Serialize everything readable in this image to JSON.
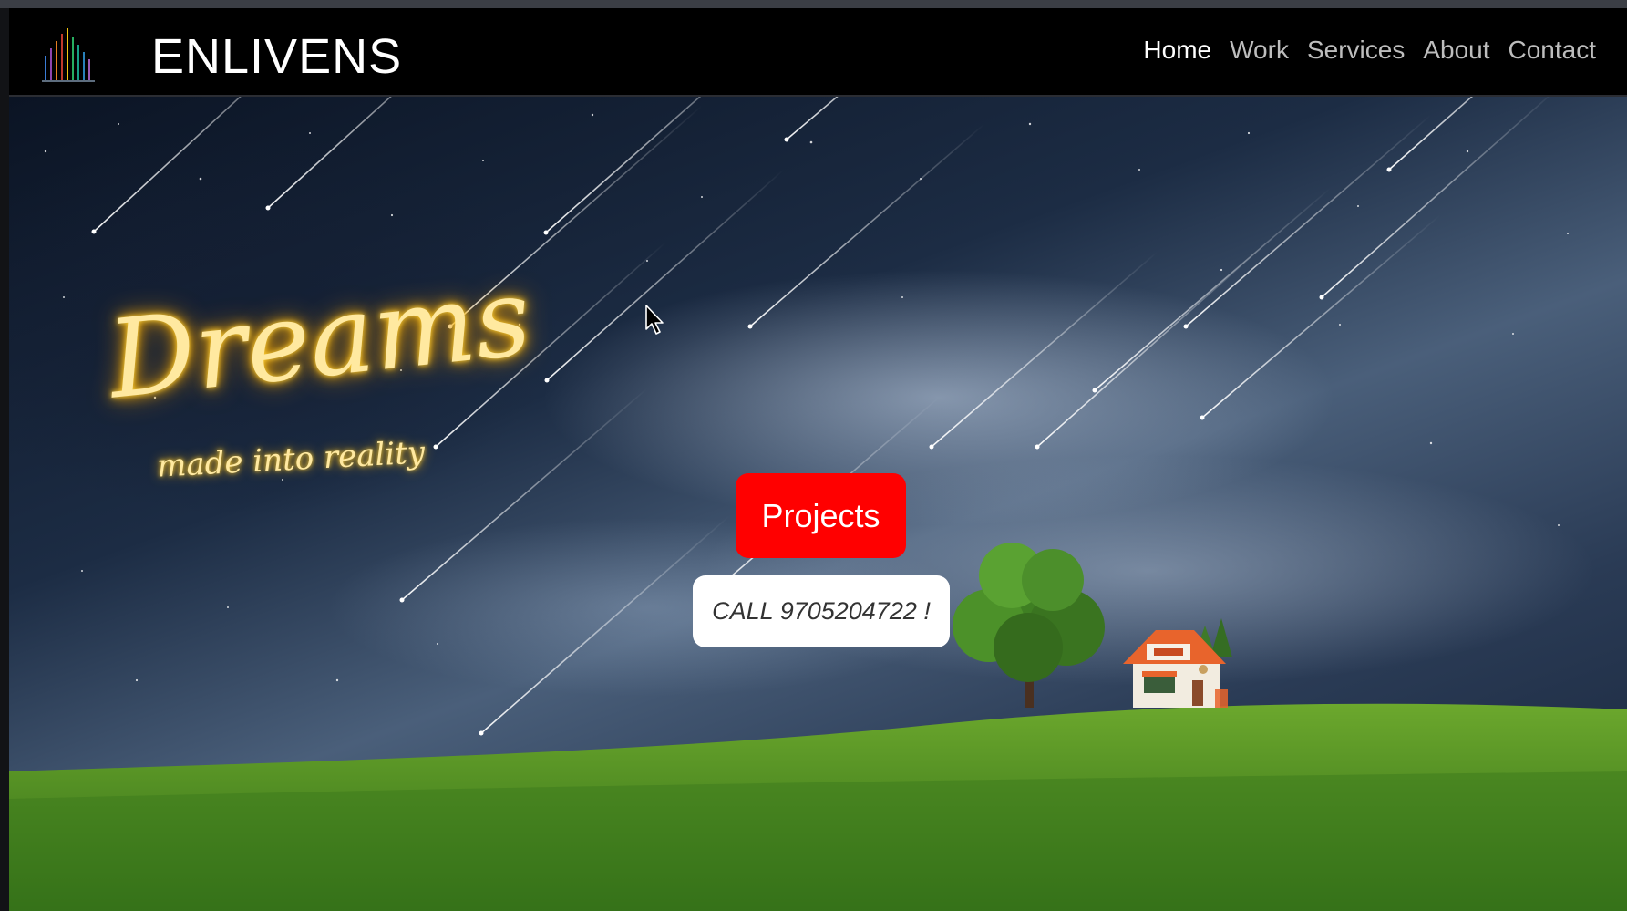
{
  "header": {
    "brand": "ENLIVENS",
    "nav": [
      "Home",
      "Work",
      "Services",
      "About",
      "Contact"
    ],
    "active_index": 0
  },
  "hero": {
    "script_title": "Dreams",
    "script_subtitle": "made into reality",
    "projects_button": "Projects",
    "call_button": "CALL 9705204722 !"
  },
  "colors": {
    "projects_button_bg": "#ff0000",
    "call_button_bg": "#ffffff",
    "neon_glow": "#ffd23a"
  },
  "icons": [
    "logo-icon",
    "mouse-cursor-icon"
  ]
}
